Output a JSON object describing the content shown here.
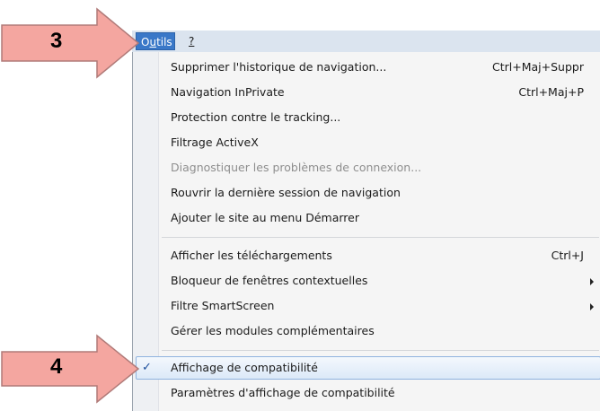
{
  "menubar": {
    "items": [
      {
        "label": "Outils",
        "accel_index": 1
      },
      {
        "label": "?"
      }
    ]
  },
  "menu": {
    "group1": [
      {
        "label": "Supprimer l'historique de navigation...",
        "shortcut": "Ctrl+Maj+Suppr"
      },
      {
        "label": "Navigation InPrivate",
        "shortcut": "Ctrl+Maj+P"
      },
      {
        "label": "Protection contre le tracking..."
      },
      {
        "label": "Filtrage ActiveX"
      },
      {
        "label": "Diagnostiquer les problèmes de connexion...",
        "disabled": true
      },
      {
        "label": "Rouvrir la dernière session de navigation"
      },
      {
        "label": "Ajouter le site au menu Démarrer"
      }
    ],
    "group2": [
      {
        "label": "Afficher les téléchargements",
        "shortcut": "Ctrl+J"
      },
      {
        "label": "Bloqueur de fenêtres contextuelles",
        "submenu": true
      },
      {
        "label": "Filtre SmartScreen",
        "submenu": true
      },
      {
        "label": "Gérer les modules complémentaires"
      }
    ],
    "group3": [
      {
        "label": "Affichage de compatibilité",
        "checked": true,
        "check_mark": "✓"
      },
      {
        "label": "Paramètres d'affichage de compatibilité"
      }
    ]
  },
  "callouts": {
    "step3": "3",
    "step4": "4"
  },
  "colors": {
    "arrow_fill": "#f4a6a0",
    "arrow_stroke": "#b07a78",
    "menubar_active": "#3a78c8",
    "highlight_border": "#8fb3df"
  }
}
